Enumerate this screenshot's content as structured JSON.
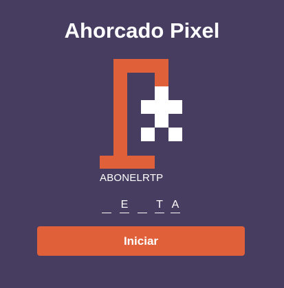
{
  "title": "Ahorcado Pixel",
  "wrong_letters": "ABONELRTP",
  "word": [
    "",
    "E",
    "",
    "T",
    "A"
  ],
  "start_button_label": "Iniciar",
  "colors": {
    "background": "#473d61",
    "gallows": "#e0603a",
    "figure": "#ffffff",
    "button": "#e0603a",
    "text": "#ffffff"
  }
}
